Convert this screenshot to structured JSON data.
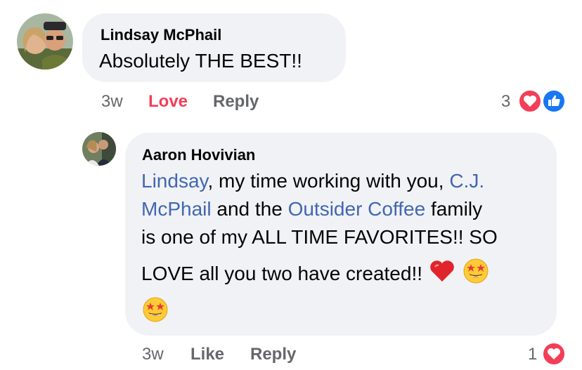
{
  "comment1": {
    "author": "Lindsay McPhail",
    "text": "Absolutely THE BEST!!",
    "time": "3w",
    "love_label": "Love",
    "reply_label": "Reply",
    "reaction_count": "3",
    "reactions": [
      "heart-icon",
      "like-icon"
    ]
  },
  "comment2": {
    "author": "Aaron Hovivian",
    "line1_mention": "Lindsay",
    "line1_text": ", my time working with you, ",
    "line1_mention2": "C.J.",
    "line2_mention": "McPhail",
    "line2_text": " and the ",
    "line2_mention2": "Outsider Coffee",
    "line2_text2": " family",
    "line3_text": "is one of my ALL TIME FAVORITES!! SO",
    "line4_text": "LOVE all you two have created!!",
    "time": "3w",
    "like_label": "Like",
    "reply_label": "Reply",
    "reaction_count": "1",
    "reactions": [
      "heart-icon"
    ]
  },
  "colors": {
    "bubble": "#f0f2f5",
    "mention": "#4267b2",
    "love": "#f33e58",
    "like": "#1877f2",
    "meta": "#65676b"
  }
}
